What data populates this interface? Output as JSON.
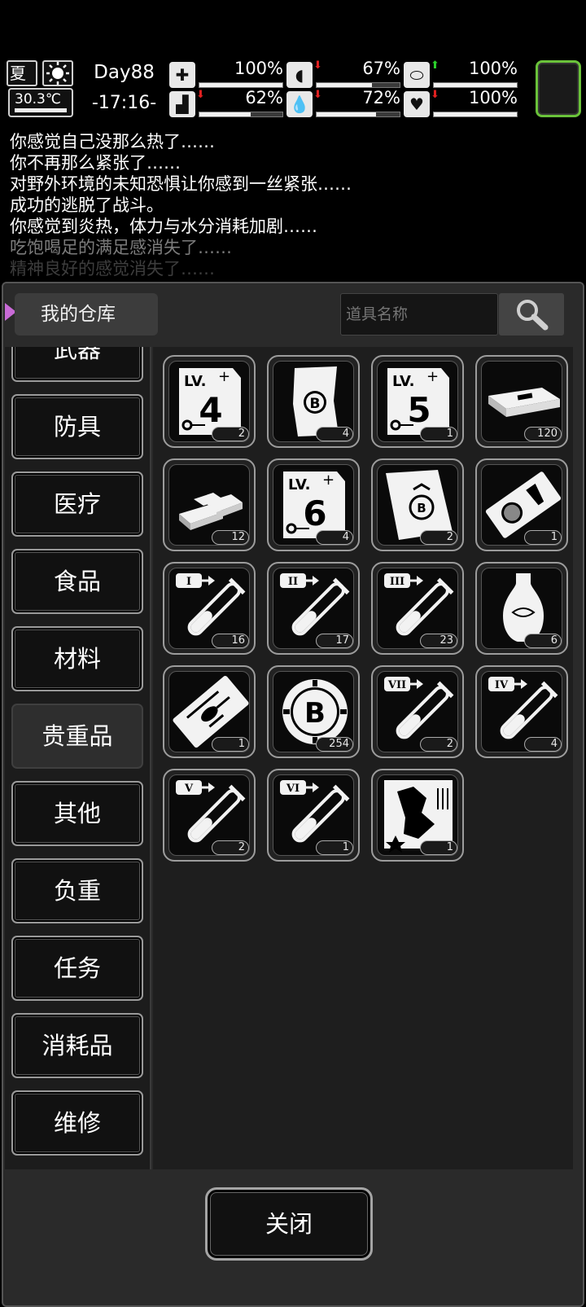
{
  "hud": {
    "season": "夏",
    "temperature": "30.3℃",
    "day": "Day88",
    "time": "-17:16-",
    "stats": [
      {
        "icon": "medkit-icon",
        "percent": "100%",
        "value": 1.0,
        "trend": "none"
      },
      {
        "icon": "stomach-icon",
        "percent": "67%",
        "value": 0.67,
        "trend": "down"
      },
      {
        "icon": "pill-icon",
        "percent": "100%",
        "value": 1.0,
        "trend": "up"
      },
      {
        "icon": "boot-icon",
        "percent": "62%",
        "value": 0.62,
        "trend": "down"
      },
      {
        "icon": "water-drop-icon",
        "percent": "72%",
        "value": 0.72,
        "trend": "down"
      },
      {
        "icon": "heart-icon",
        "percent": "100%",
        "value": 1.0,
        "trend": "down"
      }
    ]
  },
  "log": [
    "你感觉自己没那么热了……",
    "你不再那么紧张了……",
    "对野外环境的未知恐惧让你感到一丝紧张……",
    "成功的逃脱了战斗。",
    "你感觉到炎热，体力与水分消耗加剧……",
    "吃饱喝足的满足感消失了……",
    "精神良好的感觉消失了……"
  ],
  "warehouse": {
    "title": "我的仓库",
    "search_placeholder": "道具名称"
  },
  "categories": [
    "武器",
    "防具",
    "医疗",
    "食品",
    "材料",
    "贵重品",
    "其他",
    "负重",
    "任务",
    "消耗品",
    "维修"
  ],
  "active_category": "贵重品",
  "items": [
    {
      "icon": "lv4-blueprint-icon",
      "count": "2"
    },
    {
      "icon": "b-coupon-icon",
      "count": "4"
    },
    {
      "icon": "lv5-blueprint-icon",
      "count": "1"
    },
    {
      "icon": "cash-stack-icon",
      "count": "120"
    },
    {
      "icon": "gold-bars-icon",
      "count": "12"
    },
    {
      "icon": "lv6-blueprint-icon",
      "count": "4"
    },
    {
      "icon": "b-scroll-icon",
      "count": "2"
    },
    {
      "icon": "ticket-icon",
      "count": "1"
    },
    {
      "icon": "test-tube-i-icon",
      "count": "16"
    },
    {
      "icon": "test-tube-ii-icon",
      "count": "17"
    },
    {
      "icon": "test-tube-iii-icon",
      "count": "23"
    },
    {
      "icon": "vase-icon",
      "count": "6"
    },
    {
      "icon": "helicopter-ticket-icon",
      "count": "1"
    },
    {
      "icon": "b-chip-icon",
      "count": "254"
    },
    {
      "icon": "test-tube-vii-icon",
      "count": "2"
    },
    {
      "icon": "test-tube-iv-icon",
      "count": "4"
    },
    {
      "icon": "test-tube-v-icon",
      "count": "2"
    },
    {
      "icon": "test-tube-vi-icon",
      "count": "1"
    },
    {
      "icon": "map-fragment-icon",
      "count": "1"
    }
  ],
  "tube_labels": [
    "I",
    "II",
    "III",
    "VII",
    "IV",
    "V",
    "VI"
  ],
  "close_label": "关闭"
}
